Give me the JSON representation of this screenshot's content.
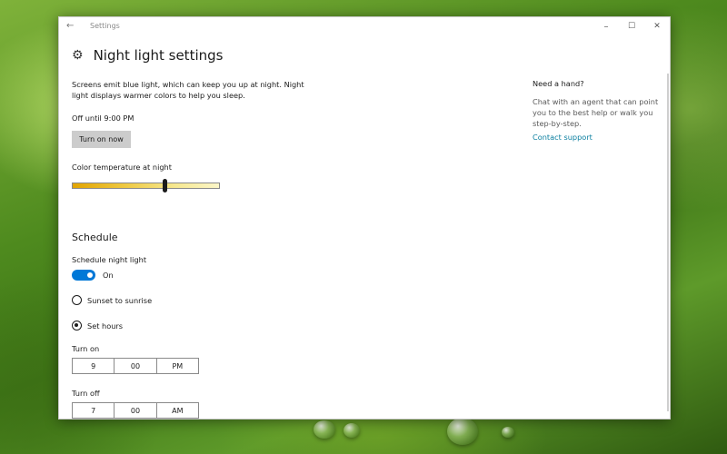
{
  "window": {
    "app_title": "Settings",
    "back_icon": "←",
    "minimize_icon": "–",
    "maximize_icon": "☐",
    "close_icon": "✕"
  },
  "header": {
    "gear_icon": "⚙",
    "title": "Night light settings"
  },
  "main": {
    "description": "Screens emit blue light, which can keep you up at night. Night light displays warmer colors to help you sleep.",
    "status": "Off until 9:00 PM",
    "turn_on_label": "Turn on now",
    "color_temp_label": "Color temperature at night",
    "color_temp_level": 0.63,
    "schedule_title": "Schedule",
    "schedule_toggle_label": "Schedule night light",
    "schedule_toggle_state": "On",
    "schedule_on": true,
    "options": [
      {
        "label": "Sunset to sunrise",
        "checked": false
      },
      {
        "label": "Set hours",
        "checked": true
      }
    ],
    "turn_on": {
      "label": "Turn on",
      "hour": "9",
      "minute": "00",
      "period": "PM"
    },
    "turn_off": {
      "label": "Turn off",
      "hour": "7",
      "minute": "00",
      "period": "AM"
    }
  },
  "side": {
    "title": "Need a hand?",
    "text": "Chat with an agent that can point you to the best help or walk you step-by-step.",
    "link": "Contact support"
  },
  "colors": {
    "accent": "#0078d7",
    "link": "#0b7fa0"
  }
}
